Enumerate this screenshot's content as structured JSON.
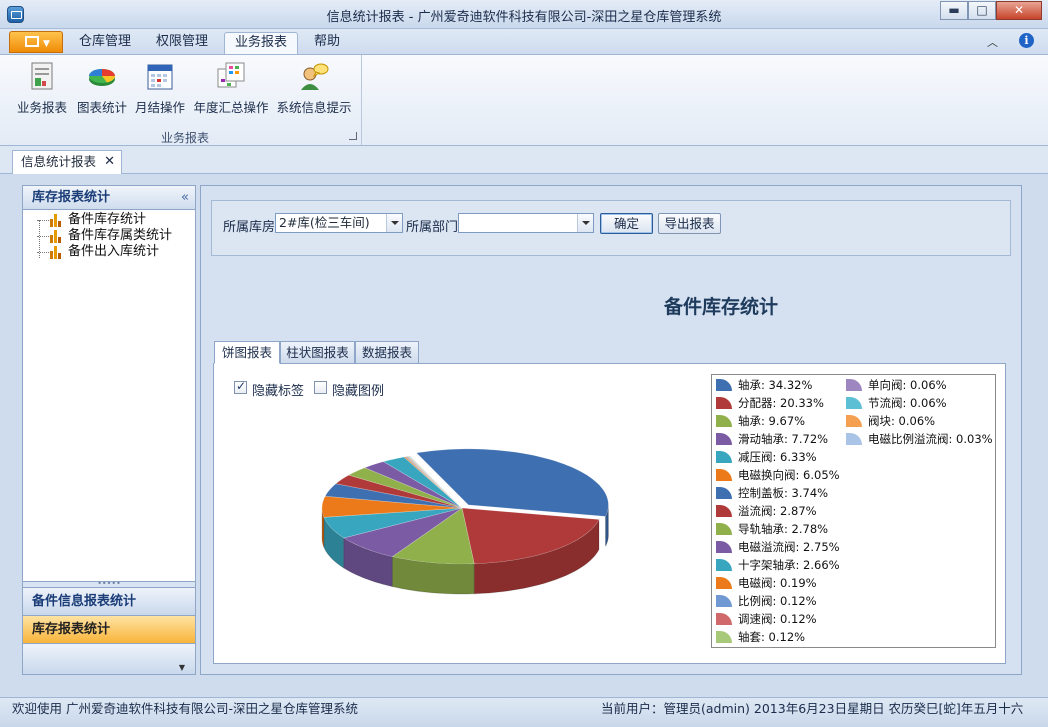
{
  "window": {
    "title": "信息统计报表 - 广州爱奇迪软件科技有限公司-深田之星仓库管理系统",
    "minimize": "▬",
    "maximize": "□",
    "close": "✕"
  },
  "menu": {
    "tabs": [
      "仓库管理",
      "权限管理",
      "业务报表",
      "帮助"
    ],
    "collapse": "︿",
    "info": "i"
  },
  "ribbon": {
    "buttons": [
      {
        "label": "业务报表",
        "icon": "report-document-icon"
      },
      {
        "label": "图表统计",
        "icon": "pie-chart-icon"
      },
      {
        "label": "月结操作",
        "icon": "calendar-icon"
      },
      {
        "label": "年度汇总操作",
        "icon": "yearly-summary-icon"
      },
      {
        "label": "系统信息提示",
        "icon": "user-message-icon"
      }
    ],
    "group_label": "业务报表"
  },
  "doc_tab": {
    "label": "信息统计报表",
    "close": "✕"
  },
  "left": {
    "header": "库存报表统计",
    "collapse": "«",
    "tree": [
      "备件库存统计",
      "备件库存属类统计",
      "备件出入库统计"
    ],
    "splitter": "•••••",
    "nav": [
      "备件信息报表统计",
      "库存报表统计"
    ],
    "more": "▼"
  },
  "filter": {
    "warehouse_label": "所属库房",
    "warehouse_value": "2#库(检三车间)",
    "dept_label": "所属部门",
    "dept_value": "",
    "ok": "确定",
    "export": "导出报表"
  },
  "report_title": "备件库存统计",
  "chart_tabs": [
    "饼图报表",
    "柱状图报表",
    "数据报表"
  ],
  "options": {
    "hide_labels": "隐藏标签",
    "hide_legend": "隐藏图例",
    "hide_labels_checked": true,
    "hide_legend_checked": false
  },
  "chart_data": {
    "type": "pie",
    "title": "",
    "series": [
      {
        "name": "",
        "values": [
          34.32,
          20.33,
          9.67,
          7.72,
          6.33,
          6.05,
          3.74,
          2.87,
          2.78,
          2.75,
          2.66,
          0.19,
          0.12,
          0.12,
          0.12,
          0.06,
          0.06,
          0.06,
          0.03
        ]
      }
    ],
    "categories": [
      "轴承",
      "分配器",
      "轴承",
      "滑动轴承",
      "减压阀",
      "电磁换向阀",
      "控制盖板",
      "溢流阀",
      "导轨轴承",
      "电磁溢流阀",
      "十字架轴承",
      "电磁阀",
      "比例阀",
      "调速阀",
      "轴套",
      "单向阀",
      "节流阀",
      "阀块",
      "电磁比例溢流阀"
    ],
    "labels": [
      "轴承: 34.32%",
      "分配器: 20.33%",
      "轴承: 9.67%",
      "滑动轴承: 7.72%",
      "减压阀: 6.33%",
      "电磁换向阀: 6.05%",
      "控制盖板: 3.74%",
      "溢流阀: 2.87%",
      "导轨轴承: 2.78%",
      "电磁溢流阀: 2.75%",
      "十字架轴承: 2.66%",
      "电磁阀: 0.19%",
      "比例阀: 0.12%",
      "调速阀: 0.12%",
      "轴套: 0.12%",
      "单向阀: 0.06%",
      "节流阀: 0.06%",
      "阀块: 0.06%",
      "电磁比例溢流阀: 0.03%"
    ],
    "colors": [
      "#3e6fb0",
      "#b03a3a",
      "#8fb04a",
      "#7a5ba4",
      "#38a6bf",
      "#ec7a1a",
      "#3e6fb0",
      "#b03a3a",
      "#8fb04a",
      "#7a5ba4",
      "#38a6bf",
      "#ec7a1a",
      "#7099d4",
      "#d06a6a",
      "#a8c87a",
      "#9e86c0",
      "#5cbfd4",
      "#f4a050",
      "#a9c4e6"
    ],
    "legend": "right",
    "exploded_index": 0
  },
  "status": {
    "welcome": "欢迎使用  广州爱奇迪软件科技有限公司-深田之星仓库管理系统",
    "user": "当前用户：管理员(admin)   2013年6月23日星期日  农历癸巳[蛇]年五月十六"
  }
}
